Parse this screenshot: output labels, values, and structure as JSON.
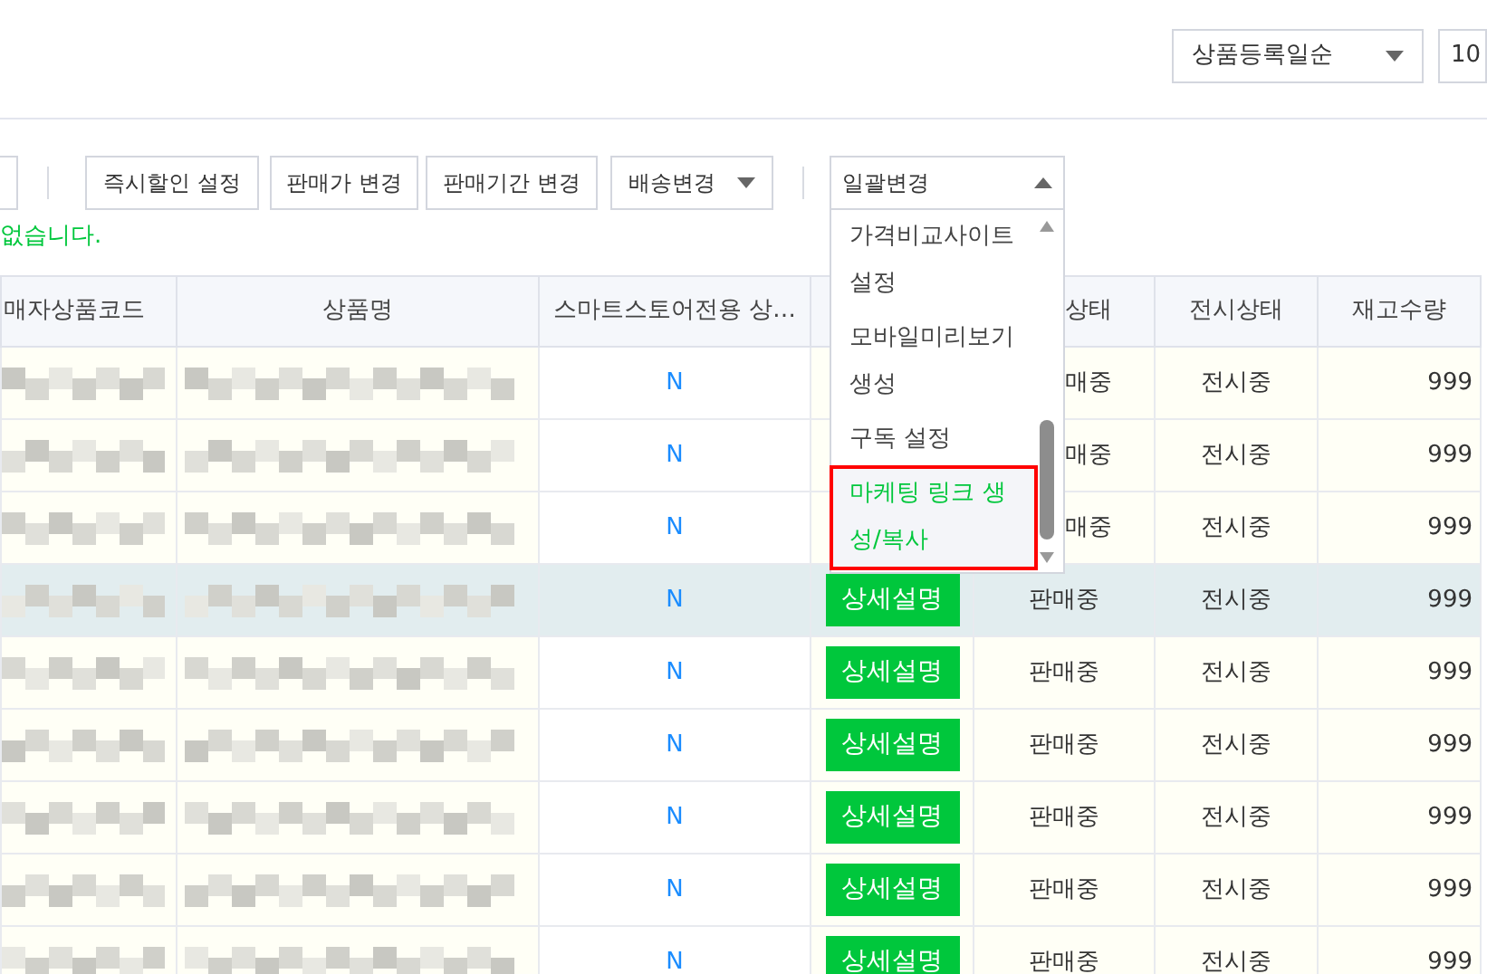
{
  "sort_select": {
    "value": "상품등록일순"
  },
  "page_size_select": {
    "value": "10"
  },
  "toolbar": {
    "buttons": [
      {
        "label": "즉시할인 설정",
        "kind": "plain"
      },
      {
        "label": "판매가 변경",
        "kind": "plain"
      },
      {
        "label": "판매기간 변경",
        "kind": "plain"
      },
      {
        "label": "배송변경",
        "kind": "dropdown"
      }
    ],
    "bulk_button": {
      "label": "일괄변경",
      "expanded": true
    }
  },
  "notice": "없습니다.",
  "bulk_menu": {
    "items": [
      {
        "label": "가격비교사이트 설정",
        "selected": false
      },
      {
        "label": "모바일미리보기 생성",
        "selected": false
      },
      {
        "label": "구독 설정",
        "selected": false
      },
      {
        "label": "마케팅 링크 생성/복사",
        "selected": true
      }
    ]
  },
  "table": {
    "columns": [
      {
        "label": "매자상품코드",
        "kind": "plain"
      },
      {
        "label": "상품명",
        "kind": "plain"
      },
      {
        "label": "스마트스토어전용 상…",
        "kind": "plain"
      },
      {
        "label": "상태",
        "kind": "covered"
      },
      {
        "label": "전시상태",
        "kind": "plain"
      },
      {
        "label": "재고수량",
        "kind": "plain"
      }
    ],
    "rows": [
      {
        "exclusive": "N",
        "sale_status": "매중",
        "covered": true,
        "display_status": "전시중",
        "stock": "999",
        "hovered": false
      },
      {
        "exclusive": "N",
        "sale_status": "매중",
        "covered": true,
        "display_status": "전시중",
        "stock": "999",
        "hovered": false
      },
      {
        "exclusive": "N",
        "sale_status": "매중",
        "covered": true,
        "display_status": "전시중",
        "stock": "999",
        "hovered": false
      },
      {
        "exclusive": "N",
        "detail_button": "상세설명",
        "sale_status": "판매중",
        "covered": false,
        "display_status": "전시중",
        "stock": "999",
        "hovered": true
      },
      {
        "exclusive": "N",
        "detail_button": "상세설명",
        "sale_status": "판매중",
        "covered": false,
        "display_status": "전시중",
        "stock": "999",
        "hovered": false
      },
      {
        "exclusive": "N",
        "detail_button": "상세설명",
        "sale_status": "판매중",
        "covered": false,
        "display_status": "전시중",
        "stock": "999",
        "hovered": false
      },
      {
        "exclusive": "N",
        "detail_button": "상세설명",
        "sale_status": "판매중",
        "covered": false,
        "display_status": "전시중",
        "stock": "999",
        "hovered": false
      },
      {
        "exclusive": "N",
        "detail_button": "상세설명",
        "sale_status": "판매중",
        "covered": false,
        "display_status": "전시중",
        "stock": "999",
        "hovered": false
      },
      {
        "exclusive": "N",
        "detail_button": "상세설명",
        "sale_status": "판매중",
        "covered": false,
        "display_status": "전시중",
        "stock": "999",
        "hovered": false
      }
    ]
  }
}
